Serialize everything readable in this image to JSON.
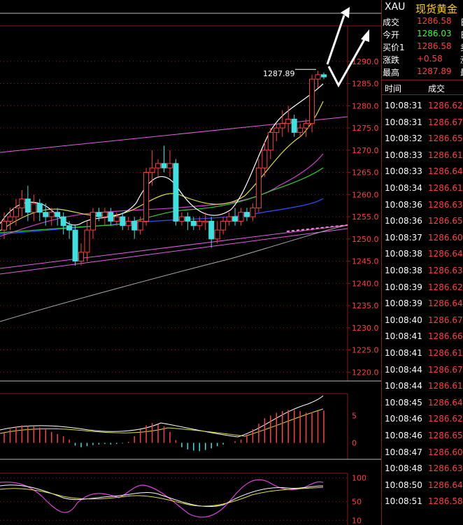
{
  "header": {
    "symbol": "XAU",
    "name": "现货黄金"
  },
  "quote": [
    {
      "label": "成交",
      "value": "1286.58",
      "color": "#ff4040",
      "extra": "日"
    },
    {
      "label": "今开",
      "value": "1286.03",
      "color": "#33ff33",
      "extra": "日"
    },
    {
      "label": "买价1",
      "value": "1286.58",
      "color": "#ff4040",
      "extra": "卖"
    },
    {
      "label": "涨跌",
      "value": "+0.58",
      "color": "#ff4040",
      "extra": "涨"
    },
    {
      "label": "最高",
      "value": "1287.89",
      "color": "#ff4040",
      "extra": "最"
    }
  ],
  "ticks": {
    "header_time": "时间",
    "header_price": "成交",
    "rows": [
      {
        "time": "10:08:31",
        "price": "1286.62"
      },
      {
        "time": "10:08:31",
        "price": "1286.67"
      },
      {
        "time": "10:08:32",
        "price": "1286.65"
      },
      {
        "time": "10:08:33",
        "price": "1286.61"
      },
      {
        "time": "10:08:33",
        "price": "1286.64"
      },
      {
        "time": "10:08:34",
        "price": "1286.61"
      },
      {
        "time": "10:08:36",
        "price": "1286.63"
      },
      {
        "time": "10:08:36",
        "price": "1286.65"
      },
      {
        "time": "10:08:37",
        "price": "1286.60"
      },
      {
        "time": "10:08:38",
        "price": "1286.64"
      },
      {
        "time": "10:08:38",
        "price": "1286.63"
      },
      {
        "time": "10:08:39",
        "price": "1286.62"
      },
      {
        "time": "10:08:39",
        "price": "1286.64"
      },
      {
        "time": "10:08:40",
        "price": "1286.67"
      },
      {
        "time": "10:08:41",
        "price": "1286.66"
      },
      {
        "time": "10:08:41",
        "price": "1286.61"
      },
      {
        "time": "10:08:44",
        "price": "1286.67"
      },
      {
        "time": "10:08:44",
        "price": "1286.61"
      },
      {
        "time": "10:08:45",
        "price": "1286.64"
      },
      {
        "time": "10:08:46",
        "price": "1286.62"
      },
      {
        "time": "10:08:46",
        "price": "1286.65"
      },
      {
        "time": "10:08:47",
        "price": "1286.60"
      },
      {
        "time": "10:08:48",
        "price": "1286.63"
      },
      {
        "time": "10:08:50",
        "price": "1286.64"
      },
      {
        "time": "10:08:51",
        "price": "1286.58"
      }
    ]
  },
  "chart_data": {
    "type": "candlestick",
    "price_axis": {
      "range": [
        1218,
        1298
      ],
      "ticks": [
        "1290.0",
        "1285.0",
        "1280.0",
        "1275.0",
        "1270.0",
        "1265.0",
        "1260.0",
        "1255.0",
        "1250.0",
        "1245.0",
        "1240.0",
        "1235.0",
        "1230.0",
        "1225.0",
        "1220.0"
      ],
      "tick_values": [
        1290,
        1285,
        1280,
        1275,
        1270,
        1265,
        1260,
        1255,
        1250,
        1245,
        1240,
        1235,
        1230,
        1225,
        1220
      ]
    },
    "high_annotation": "1287.89",
    "high_value": 1287.89,
    "candles": [
      {
        "o": 1252,
        "c": 1254,
        "h": 1256,
        "l": 1250
      },
      {
        "o": 1254,
        "c": 1255,
        "h": 1257,
        "l": 1252
      },
      {
        "o": 1255,
        "c": 1257,
        "h": 1259,
        "l": 1253
      },
      {
        "o": 1257,
        "c": 1259,
        "h": 1261,
        "l": 1255
      },
      {
        "o": 1259,
        "c": 1256,
        "h": 1262,
        "l": 1254
      },
      {
        "o": 1256,
        "c": 1258,
        "h": 1260,
        "l": 1254
      },
      {
        "o": 1258,
        "c": 1256,
        "h": 1259,
        "l": 1254
      },
      {
        "o": 1256,
        "c": 1255,
        "h": 1258,
        "l": 1253
      },
      {
        "o": 1255,
        "c": 1256,
        "h": 1257,
        "l": 1253
      },
      {
        "o": 1256,
        "c": 1255,
        "h": 1257,
        "l": 1253
      },
      {
        "o": 1255,
        "c": 1253,
        "h": 1256,
        "l": 1251
      },
      {
        "o": 1253,
        "c": 1252,
        "h": 1254,
        "l": 1250
      },
      {
        "o": 1252,
        "c": 1245,
        "h": 1253,
        "l": 1244
      },
      {
        "o": 1245,
        "c": 1247,
        "h": 1249,
        "l": 1244
      },
      {
        "o": 1247,
        "c": 1252,
        "h": 1254,
        "l": 1245
      },
      {
        "o": 1252,
        "c": 1256,
        "h": 1257,
        "l": 1250
      },
      {
        "o": 1256,
        "c": 1255,
        "h": 1257,
        "l": 1254
      },
      {
        "o": 1255,
        "c": 1256,
        "h": 1257,
        "l": 1253
      },
      {
        "o": 1256,
        "c": 1254,
        "h": 1257,
        "l": 1253
      },
      {
        "o": 1254,
        "c": 1255,
        "h": 1256,
        "l": 1253
      },
      {
        "o": 1255,
        "c": 1253,
        "h": 1256,
        "l": 1252
      },
      {
        "o": 1253,
        "c": 1254,
        "h": 1255,
        "l": 1252
      },
      {
        "o": 1254,
        "c": 1252,
        "h": 1255,
        "l": 1250
      },
      {
        "o": 1252,
        "c": 1254,
        "h": 1255,
        "l": 1251
      },
      {
        "o": 1254,
        "c": 1265,
        "h": 1266,
        "l": 1253
      },
      {
        "o": 1265,
        "c": 1266,
        "h": 1270,
        "l": 1262
      },
      {
        "o": 1266,
        "c": 1267,
        "h": 1268,
        "l": 1264
      },
      {
        "o": 1267,
        "c": 1266,
        "h": 1271,
        "l": 1265
      },
      {
        "o": 1266,
        "c": 1267,
        "h": 1270,
        "l": 1264
      },
      {
        "o": 1267,
        "c": 1254,
        "h": 1268,
        "l": 1253
      },
      {
        "o": 1254,
        "c": 1255,
        "h": 1256,
        "l": 1253
      },
      {
        "o": 1255,
        "c": 1254,
        "h": 1256,
        "l": 1252
      },
      {
        "o": 1254,
        "c": 1253,
        "h": 1255,
        "l": 1252
      },
      {
        "o": 1253,
        "c": 1254,
        "h": 1255,
        "l": 1252
      },
      {
        "o": 1254,
        "c": 1254,
        "h": 1256,
        "l": 1252
      },
      {
        "o": 1254,
        "c": 1250,
        "h": 1255,
        "l": 1248
      },
      {
        "o": 1250,
        "c": 1252,
        "h": 1254,
        "l": 1249
      },
      {
        "o": 1252,
        "c": 1254,
        "h": 1255,
        "l": 1251
      },
      {
        "o": 1254,
        "c": 1255,
        "h": 1256,
        "l": 1253
      },
      {
        "o": 1255,
        "c": 1254,
        "h": 1257,
        "l": 1253
      },
      {
        "o": 1254,
        "c": 1256,
        "h": 1257,
        "l": 1253
      },
      {
        "o": 1256,
        "c": 1255,
        "h": 1257,
        "l": 1254
      },
      {
        "o": 1255,
        "c": 1257,
        "h": 1258,
        "l": 1254
      },
      {
        "o": 1257,
        "c": 1266,
        "h": 1268,
        "l": 1256
      },
      {
        "o": 1266,
        "c": 1270,
        "h": 1272,
        "l": 1264
      },
      {
        "o": 1270,
        "c": 1274,
        "h": 1275,
        "l": 1268
      },
      {
        "o": 1274,
        "c": 1275,
        "h": 1276,
        "l": 1272
      },
      {
        "o": 1275,
        "c": 1276,
        "h": 1279,
        "l": 1273
      },
      {
        "o": 1276,
        "c": 1277,
        "h": 1280,
        "l": 1274
      },
      {
        "o": 1277,
        "c": 1274,
        "h": 1278,
        "l": 1273
      },
      {
        "o": 1274,
        "c": 1275,
        "h": 1276,
        "l": 1273
      },
      {
        "o": 1275,
        "c": 1276,
        "h": 1277,
        "l": 1273
      },
      {
        "o": 1276,
        "c": 1286,
        "h": 1287,
        "l": 1274
      },
      {
        "o": 1286,
        "c": 1287,
        "h": 1287.89,
        "l": 1284
      },
      {
        "o": 1287,
        "c": 1286.5,
        "h": 1287.5,
        "l": 1286
      }
    ],
    "macd_axis": {
      "ticks": [
        "5",
        "0"
      ],
      "tick_values": [
        5,
        0
      ],
      "range": [
        -3,
        9
      ]
    },
    "macd_bars": [
      2,
      2.5,
      3,
      3.2,
      3.1,
      3,
      2.8,
      2.4,
      2,
      1.6,
      1.2,
      0.6,
      -0.5,
      -0.8,
      -0.6,
      -0.4,
      -0.3,
      -0.2,
      -0.3,
      -0.2,
      -0.1,
      0.2,
      1.2,
      2.4,
      3.2,
      3.6,
      3.4,
      3.0,
      2.0,
      0.5,
      -0.8,
      -1.2,
      -1.4,
      -1.5,
      -1.3,
      -1.0,
      -0.6,
      -0.3,
      0,
      0.3,
      0.6,
      1.5,
      2.5,
      3.5,
      4.5,
      5,
      5.5,
      5.8,
      6,
      6,
      5.8,
      5.5,
      5.6,
      5.8,
      5.9
    ],
    "kdj_axis": {
      "ticks": [
        "100",
        "50",
        "10"
      ],
      "tick_values": [
        100,
        50,
        10
      ],
      "range": [
        0,
        110
      ]
    }
  }
}
